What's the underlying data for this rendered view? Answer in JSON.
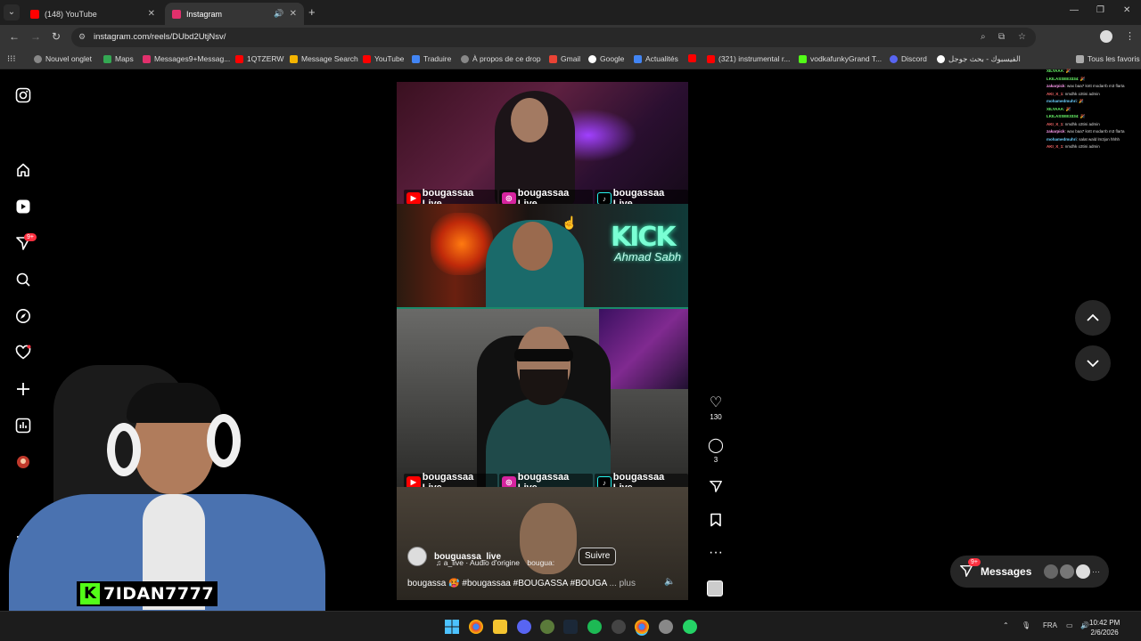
{
  "browser": {
    "tabs": [
      {
        "title": "(148) YouTube",
        "favicon_color": "#ff0000",
        "active": false
      },
      {
        "title": "Instagram",
        "favicon_color": "#e1306c",
        "active": true
      }
    ],
    "url": "instagram.com/reels/DUbd2UtjNsv/",
    "bookmarks": [
      {
        "label": "Nouvel onglet",
        "icon": "globe-icon",
        "color": "#cccccc"
      },
      {
        "label": "Maps",
        "icon": "maps-icon",
        "color": "#34a853"
      },
      {
        "label": "Messages9+Messag...",
        "icon": "instagram-icon",
        "color": "#e1306c"
      },
      {
        "label": "1QTZERW",
        "icon": "youtube-icon",
        "color": "#ff0000"
      },
      {
        "label": "Message Search",
        "icon": "chart-icon",
        "color": "#f4b400"
      },
      {
        "label": "YouTube",
        "icon": "youtube-icon",
        "color": "#ff0000"
      },
      {
        "label": "Traduire",
        "icon": "translate-icon",
        "color": "#4285f4"
      },
      {
        "label": "À propos de ce drop",
        "icon": "globe-icon",
        "color": "#cccccc"
      },
      {
        "label": "Gmail",
        "icon": "gmail-icon",
        "color": "#ea4335"
      },
      {
        "label": "Google",
        "icon": "google-icon",
        "color": "#ffffff"
      },
      {
        "label": "Actualités",
        "icon": "news-icon",
        "color": "#4285f4"
      },
      {
        "label": "",
        "icon": "youtube-icon",
        "color": "#ff0000"
      },
      {
        "label": "(321) instrumental r...",
        "icon": "youtube-icon",
        "color": "#ff0000"
      },
      {
        "label": "vodkafunkyGrand T...",
        "icon": "kick-icon",
        "color": "#53fc18"
      },
      {
        "label": "Discord",
        "icon": "discord-icon",
        "color": "#5865f2"
      },
      {
        "label": "الفيسبوك - بحث جوجل",
        "icon": "google-icon",
        "color": "#ffffff"
      },
      {
        "label": "Tous les favoris",
        "icon": "folder-icon",
        "color": "#cccccc"
      }
    ]
  },
  "instagram": {
    "sidebar": {
      "notifications_badge": "9+"
    },
    "reel": {
      "username": "bouguassa_live",
      "audio": "a_live · Audio d'origine",
      "audio_tag": "bougua:",
      "follow_label": "Suivre",
      "caption": "bougassa 🥵 #bougassaa #BOUGASSA #BOUGA",
      "more_label": "... plus",
      "overlay_label": "bougassaa Live",
      "neon_text": "KICK",
      "neon_sub": "Ahmad Sabh",
      "likes": "130",
      "comments": "3"
    },
    "messages": {
      "label": "Messages",
      "badge": "9+"
    }
  },
  "stream": {
    "streamer_name": "7IDAN7777",
    "chat_lines": [
      {
        "user": "XILYAAA",
        "text": ": 🎉",
        "color": "#6cff6c"
      },
      {
        "user": "LKILASSEE3334",
        "text": ": 🎉",
        "color": "#6cff6c"
      },
      {
        "user": "zakarpick",
        "text": ": wax baa7 kntt modarrb m3 flarta",
        "color": "#ff9cf0"
      },
      {
        "user": "AKI_X_1",
        "text": ": nmdhk o3tini admin",
        "color": "#ff6a6a"
      },
      {
        "user": "mohamedmuhri",
        "text": ": 🎉",
        "color": "#6cd0ff"
      },
      {
        "user": "XILYAAA",
        "text": ": 🎉",
        "color": "#6cff6c"
      },
      {
        "user": "LKILASSEE3334",
        "text": ": 🎉",
        "color": "#6cff6c"
      },
      {
        "user": "AKI_X_1",
        "text": ": nmdhk o3tini admin",
        "color": "#ff6a6a"
      },
      {
        "user": "zakarpick",
        "text": ": wax baa7 kntt modarrb m3 flarta",
        "color": "#ff9cf0"
      },
      {
        "user": "mohamedmuhri",
        "text": ": salat wald lm3jon hhhh",
        "color": "#6cd0ff"
      },
      {
        "user": "AKI_X_1",
        "text": ": nmdhk o3tini admin",
        "color": "#ff6a6a"
      }
    ]
  },
  "taskbar": {
    "language": "FRA",
    "time": "10:42 PM",
    "date": "2/6/2026"
  }
}
